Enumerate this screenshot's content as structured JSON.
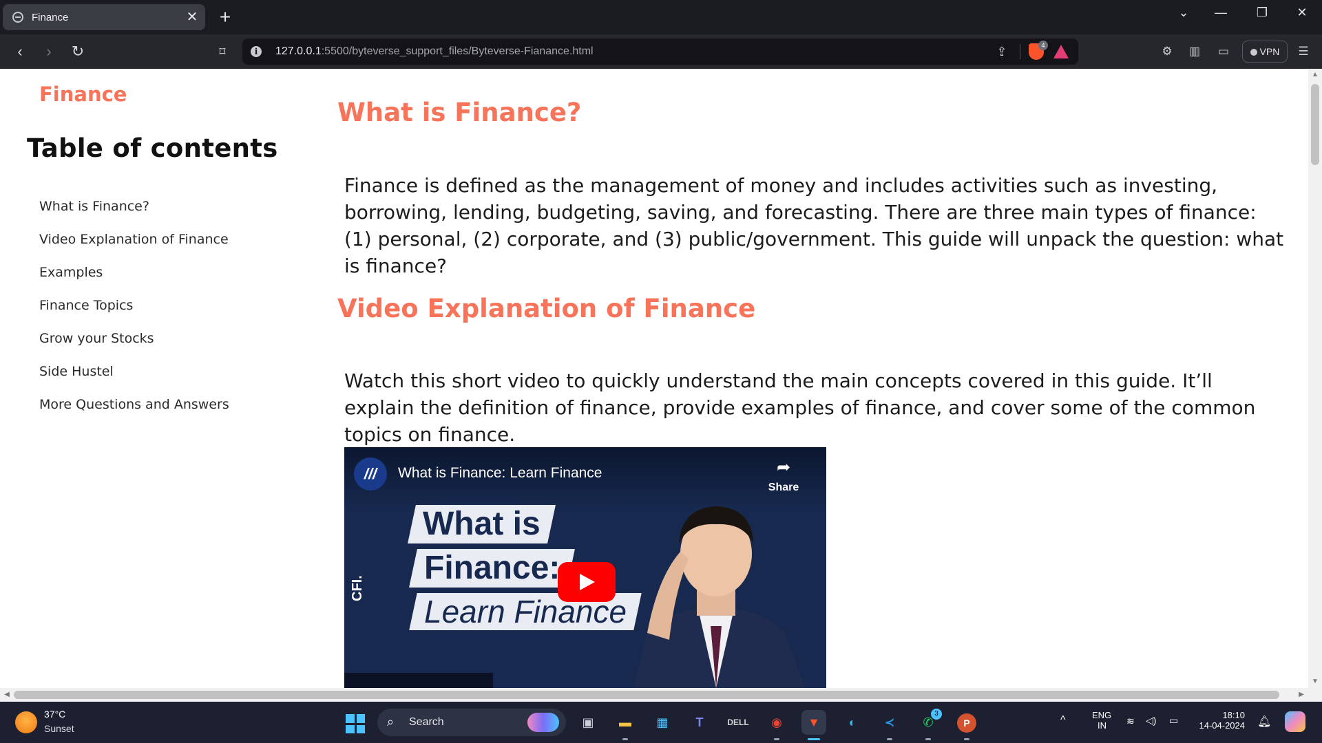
{
  "browser": {
    "tab_title": "Finance",
    "tab_close": "✕",
    "new_tab": "+",
    "url_host": "127.0.0.1",
    "url_rest": ":5500/byteverse_support_files/Byteverse-Fianance.html",
    "shield_count": "4",
    "vpn_label": "VPN"
  },
  "sidebar": {
    "brand": "Finance",
    "toc_title": "Table of contents",
    "items": [
      "What is Finance?",
      "Video Explanation of Finance",
      "Examples",
      "Finance Topics",
      "Grow your Stocks",
      "Side Hustel",
      "More Questions and Answers"
    ]
  },
  "main": {
    "section1_heading": "What is Finance?",
    "section1_text": "Finance is defined as the management of money and includes activities such as investing, borrowing, lending, budgeting, saving, and forecasting. There are three main types of finance: (1) personal, (2) corporate, and (3) public/government. This guide will unpack the question: what is finance?",
    "section2_heading": "Video Explanation of Finance",
    "section2_text": "Watch this short video to quickly understand the main concepts covered in this guide. It’ll explain the definition of finance, provide examples of finance, and cover some of the common topics on finance.",
    "video": {
      "title": "What is Finance: Learn Finance",
      "share_label": "Share",
      "thumb_line1": "What is",
      "thumb_line2": "Finance:",
      "thumb_line3": "Learn Finance",
      "channel_mark": "CFI."
    }
  },
  "taskbar": {
    "weather_temp": "37°C",
    "weather_desc": "Sunset",
    "search_label": "Search",
    "whatsapp_badge": "3",
    "lang_line1": "ENG",
    "lang_line2": "IN",
    "time": "18:10",
    "date": "14-04-2024"
  },
  "colors": {
    "accent": "#f7745a",
    "windows_blue": "#4cc2ff"
  }
}
